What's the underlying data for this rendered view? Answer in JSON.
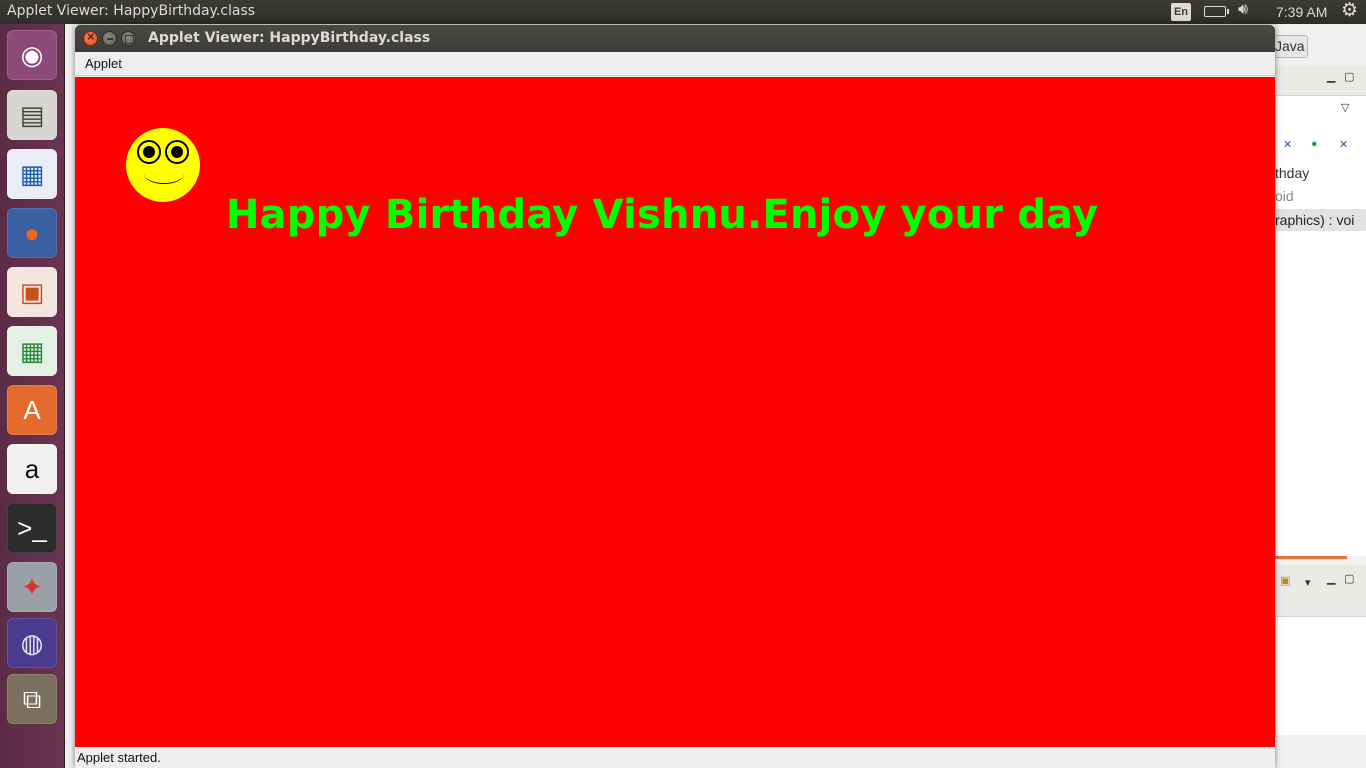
{
  "top_panel": {
    "title": "Applet Viewer: HappyBirthday.class",
    "keyboard": "En",
    "clock": "7:39 AM"
  },
  "launcher": {
    "items": [
      {
        "name": "ubuntu-dash",
        "glyph": "◉",
        "color": "#ffffff",
        "bg": "#8c4a7a"
      },
      {
        "name": "files",
        "glyph": "▤",
        "color": "#444444",
        "bg": "#d8d6d0"
      },
      {
        "name": "writer",
        "glyph": "▦",
        "color": "#1f5ea8",
        "bg": "#e9eef6"
      },
      {
        "name": "firefox",
        "glyph": "●",
        "color": "#e86a1c",
        "bg": "#3a5fa3"
      },
      {
        "name": "impress",
        "glyph": "▣",
        "color": "#c2531e",
        "bg": "#f3e6de"
      },
      {
        "name": "calc",
        "glyph": "▦",
        "color": "#2b8a3a",
        "bg": "#e6f1e6"
      },
      {
        "name": "software-center",
        "glyph": "A",
        "color": "#ffffff",
        "bg": "#e46a2e"
      },
      {
        "name": "amazon",
        "glyph": "a",
        "color": "#111111",
        "bg": "#f1f1f1"
      },
      {
        "name": "terminal",
        "glyph": ">_",
        "color": "#ffffff",
        "bg": "#2c2c2c"
      },
      {
        "name": "system-settings",
        "glyph": "✦",
        "color": "#d0392a",
        "bg": "#9ba0a6"
      },
      {
        "name": "eclipse",
        "glyph": "◍",
        "color": "#e8e4f5",
        "bg": "#4b3b8f"
      },
      {
        "name": "workspace-switcher",
        "glyph": "⧉",
        "color": "#ffffff",
        "bg": "#7b6f5d"
      }
    ]
  },
  "background_window": {
    "perspective_button": "Java",
    "outline_item_1": "thday",
    "outline_item_2": "oid",
    "outline_item_3": "raphics) : voi"
  },
  "applet_window": {
    "title": "Applet Viewer: HappyBirthday.class",
    "menu_applet": "Applet",
    "greeting": "Happy Birthday Vishnu.Enjoy your day",
    "status": "Applet started.",
    "colors": {
      "canvas": "#ff0000",
      "greeting": "#00ff00",
      "smiley": "#ffff00"
    }
  }
}
